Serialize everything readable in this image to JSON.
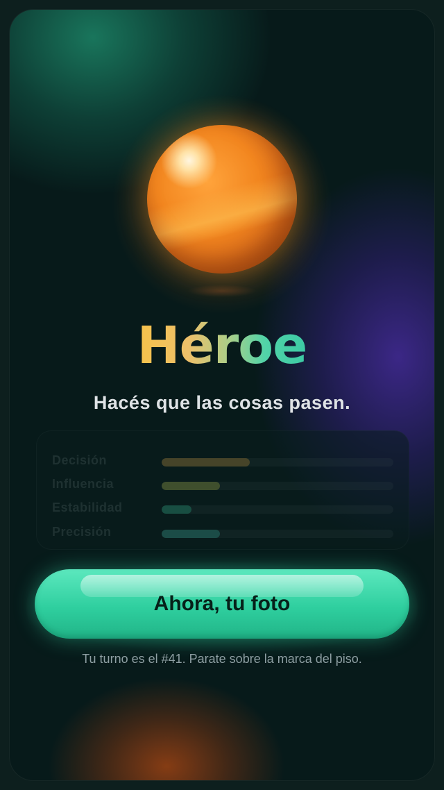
{
  "result": {
    "title": "Héroe",
    "subtitle": "Hacés que las cosas pasen."
  },
  "stats": [
    {
      "label": "Decisión",
      "value": 0.38,
      "color": "#d49a3a"
    },
    {
      "label": "Influencia",
      "value": 0.25,
      "color": "#b9c248"
    },
    {
      "label": "Estabilidad",
      "value": 0.13,
      "color": "#2fbf95"
    },
    {
      "label": "Precisión",
      "value": 0.25,
      "color": "#3ab6a6"
    }
  ],
  "cta": {
    "label": "Ahora, tu foto"
  },
  "hint": "Tu turno es el #41. Parate sobre la marca del piso."
}
